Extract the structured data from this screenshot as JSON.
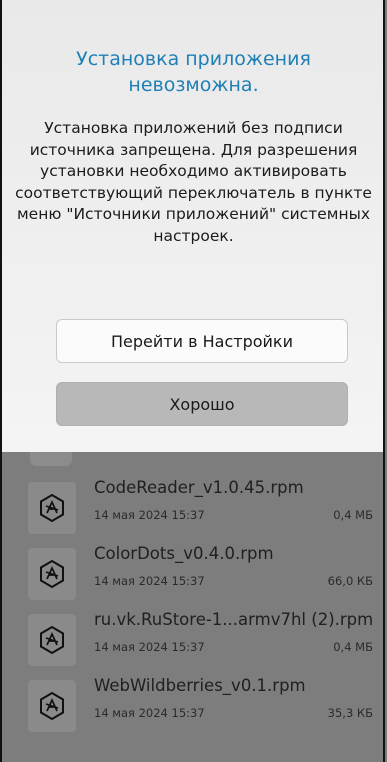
{
  "dialog": {
    "title": "Установка приложения\nневозможна.",
    "message": "Установка приложений без подписи источника запрещена. Для разрешения установки необходимо активировать соответствующий переключатель в пункте меню \"Источники приложений\" системных настроек.",
    "settings_button": "Перейти в Настройки",
    "ok_button": "Хорошо"
  },
  "files": [
    {
      "name": "CodeReader_v1.0.45.rpm",
      "date": "14 мая 2024 15:37",
      "size": "0,4 МБ",
      "icon": "package-icon"
    },
    {
      "name": "ColorDots_v0.4.0.rpm",
      "date": "14 мая 2024 15:37",
      "size": "66,0 КБ",
      "icon": "package-icon"
    },
    {
      "name": "ru.vk.RuStore-1...armv7hl (2).rpm",
      "date": "14 мая 2024 15:37",
      "size": "0,4 МБ",
      "icon": "package-icon"
    },
    {
      "name": "WebWildberries_v0.1.rpm",
      "date": "14 мая 2024 15:37",
      "size": "35,3 КБ",
      "icon": "package-icon"
    }
  ]
}
